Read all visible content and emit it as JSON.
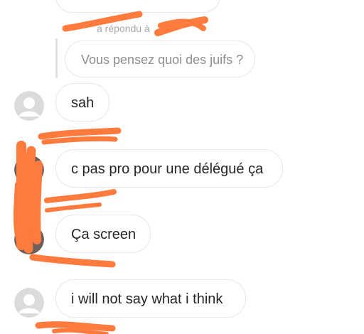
{
  "thread": {
    "reply_indicator": "a répondu à",
    "quoted_message": "Vous pensez quoi des juifs ?",
    "messages": [
      {
        "text": "sah"
      },
      {
        "text": "c pas pro pour une délégué ça"
      },
      {
        "text": "Ça screen"
      },
      {
        "text": "i will not say what i think"
      }
    ],
    "colors": {
      "redaction": "#ff7a3d",
      "bubble_border": "#e6e6e6",
      "meta_text": "#a8a8a8"
    }
  }
}
